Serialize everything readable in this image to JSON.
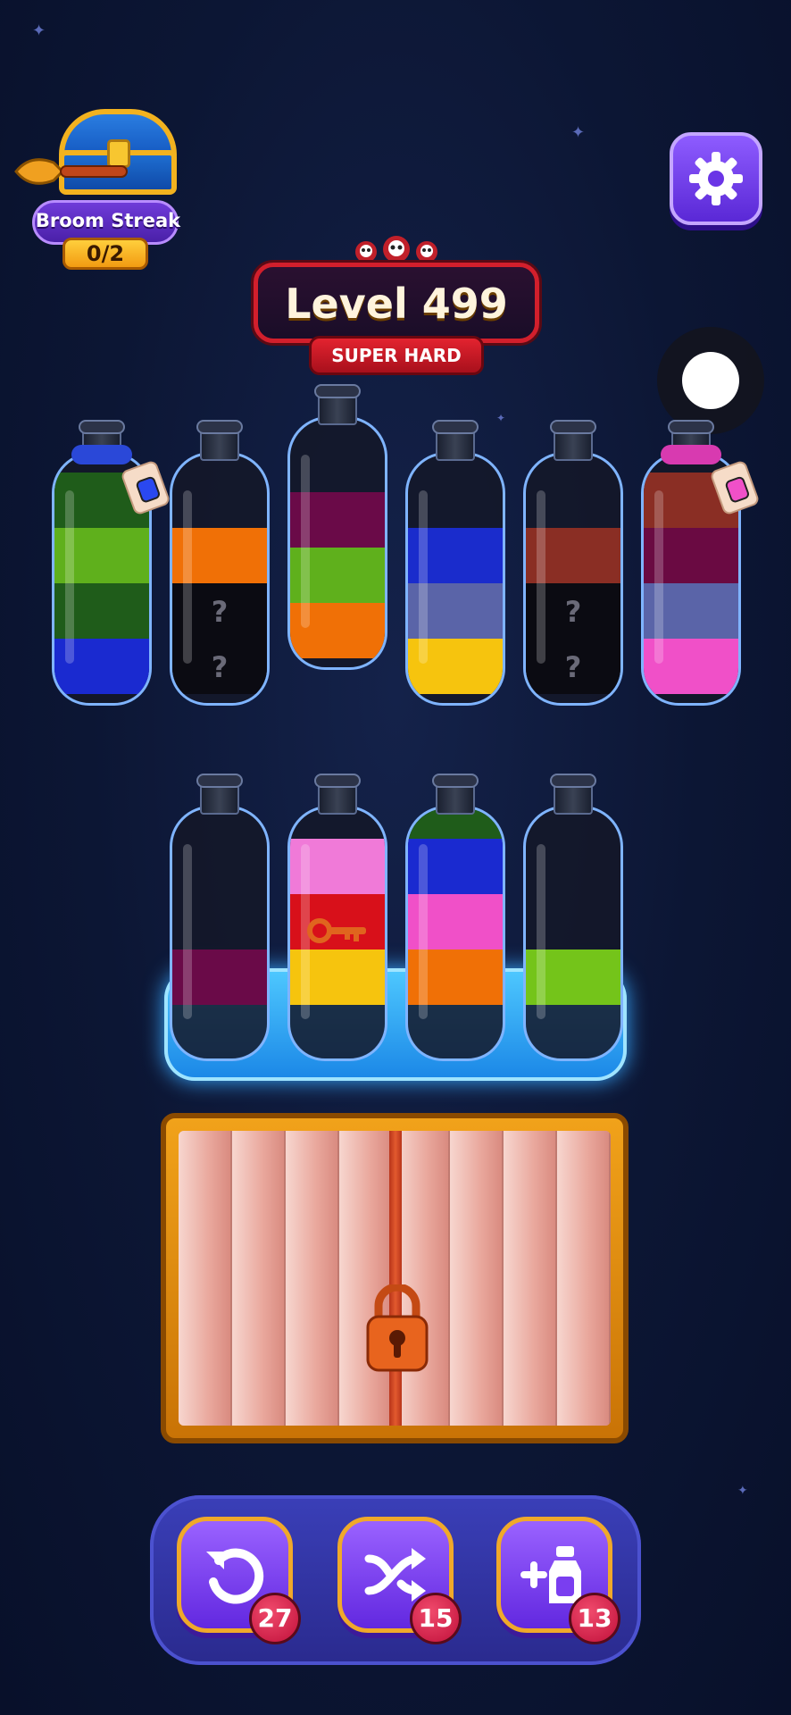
{
  "streak": {
    "label": "Broom Streak",
    "count": "0/2"
  },
  "level": {
    "title": "Level 499",
    "difficulty": "SUPER HARD"
  },
  "colors": {
    "blue": "#1a2ad0",
    "green_dark": "#1f5c1a",
    "green": "#5fb01c",
    "orange": "#f07006",
    "unknown": "#0b0b12",
    "magenta_dark": "#6a0a48",
    "navy_blue": "#1a2ccc",
    "slate": "#5a64a8",
    "yellow": "#f6c40e",
    "brown": "#8a2e24",
    "plum": "#6a0a42",
    "pink": "#f050c8",
    "light_pink": "#f07ad8",
    "red": "#d8101a",
    "lime": "#74c41a"
  },
  "bottles_top": [
    {
      "layers": [
        "green_dark",
        "green",
        "green_dark",
        "blue"
      ],
      "tag": "blue-potion"
    },
    {
      "layers": [
        "orange",
        "unknown",
        "unknown"
      ],
      "hidden": [
        "?",
        "?"
      ]
    },
    {
      "layers": [
        "magenta_dark",
        "green",
        "orange"
      ]
    },
    {
      "layers": [
        "navy_blue",
        "slate",
        "yellow"
      ]
    },
    {
      "layers": [
        "brown",
        "unknown",
        "unknown"
      ],
      "hidden": [
        "?",
        "?"
      ]
    },
    {
      "layers": [
        "brown",
        "plum",
        "slate",
        "pink"
      ],
      "tag": "pink-potion"
    }
  ],
  "bottles_frozen": [
    {
      "layers": [
        "magenta_dark"
      ]
    },
    {
      "layers": [
        "light_pink",
        "red",
        "yellow"
      ],
      "key": true
    },
    {
      "layers": [
        "green_dark",
        "blue",
        "pink",
        "orange"
      ]
    },
    {
      "layers": [
        "lime"
      ]
    }
  ],
  "tools": [
    {
      "name": "undo",
      "count": "27"
    },
    {
      "name": "shuffle",
      "count": "15"
    },
    {
      "name": "add-bottle",
      "count": "13"
    }
  ]
}
